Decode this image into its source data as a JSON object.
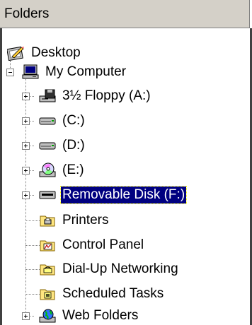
{
  "header": {
    "title": "Folders"
  },
  "tree": {
    "desktop": {
      "label": "Desktop",
      "icon": "desktop-icon"
    },
    "my_computer": {
      "label": "My Computer",
      "icon": "computer-icon",
      "expanded": true
    },
    "items": [
      {
        "label": "3½ Floppy (A:)",
        "icon": "floppy-drive-icon",
        "expandable": true
      },
      {
        "label": "(C:)",
        "icon": "hard-drive-icon",
        "expandable": true
      },
      {
        "label": "(D:)",
        "icon": "hard-drive-icon",
        "expandable": true
      },
      {
        "label": "(E:)",
        "icon": "cd-drive-icon",
        "expandable": true
      },
      {
        "label": "Removable Disk (F:)",
        "icon": "removable-disk-icon",
        "expandable": true,
        "selected": true
      },
      {
        "label": "Printers",
        "icon": "printers-folder-icon",
        "expandable": false
      },
      {
        "label": "Control Panel",
        "icon": "control-panel-icon",
        "expandable": false
      },
      {
        "label": "Dial-Up Networking",
        "icon": "dialup-networking-icon",
        "expandable": false
      },
      {
        "label": "Scheduled Tasks",
        "icon": "scheduled-tasks-icon",
        "expandable": false
      },
      {
        "label": "Web Folders",
        "icon": "web-folders-icon",
        "expandable": true
      }
    ]
  },
  "colors": {
    "selection": "#000080",
    "header_bg": "#d4d0c8"
  }
}
